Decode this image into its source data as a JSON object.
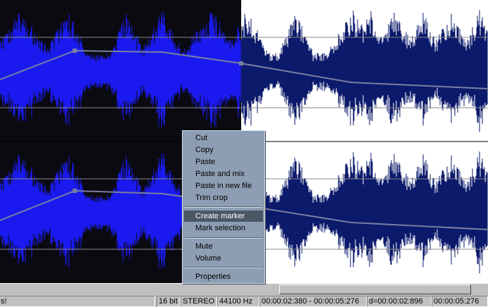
{
  "waveform": {
    "colors": {
      "selection_background": "#0a0a10",
      "unselected_background": "#ffffff",
      "selected_wave": "#1a1af0",
      "unselected_wave": "#0b1a6b",
      "envelope_line": "#7a7fa0",
      "gridline": "#8a8a8a"
    }
  },
  "context_menu": {
    "items": [
      {
        "label": "Cut"
      },
      {
        "label": "Copy"
      },
      {
        "label": "Paste"
      },
      {
        "label": "Paste and mix"
      },
      {
        "label": "Paste in new file"
      },
      {
        "label": "Trim crop"
      },
      {
        "label": "Create marker",
        "highlighted": true
      },
      {
        "label": "Mark selection"
      },
      {
        "label": "Mute"
      },
      {
        "label": "Volume"
      },
      {
        "label": "Properties"
      }
    ]
  },
  "statusbar": {
    "message": "s!",
    "bit_depth": "16 bit",
    "channels": "STEREO",
    "sample_rate": "44100 Hz",
    "selection_range": "00:00:02:380 - 00:00:05:276",
    "duration": "d=00:00:02:896",
    "total_length": "00:00:05:276"
  }
}
